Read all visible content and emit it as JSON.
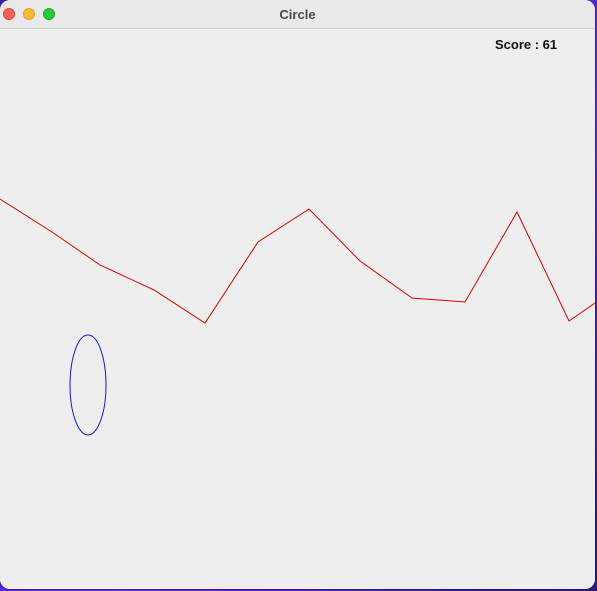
{
  "window": {
    "title": "Circle"
  },
  "hud": {
    "score_text": "Score : 61"
  },
  "game": {
    "terrain_color": "#dd0000",
    "ball_color": "#1a1acc",
    "ball_shape": "ellipse"
  }
}
